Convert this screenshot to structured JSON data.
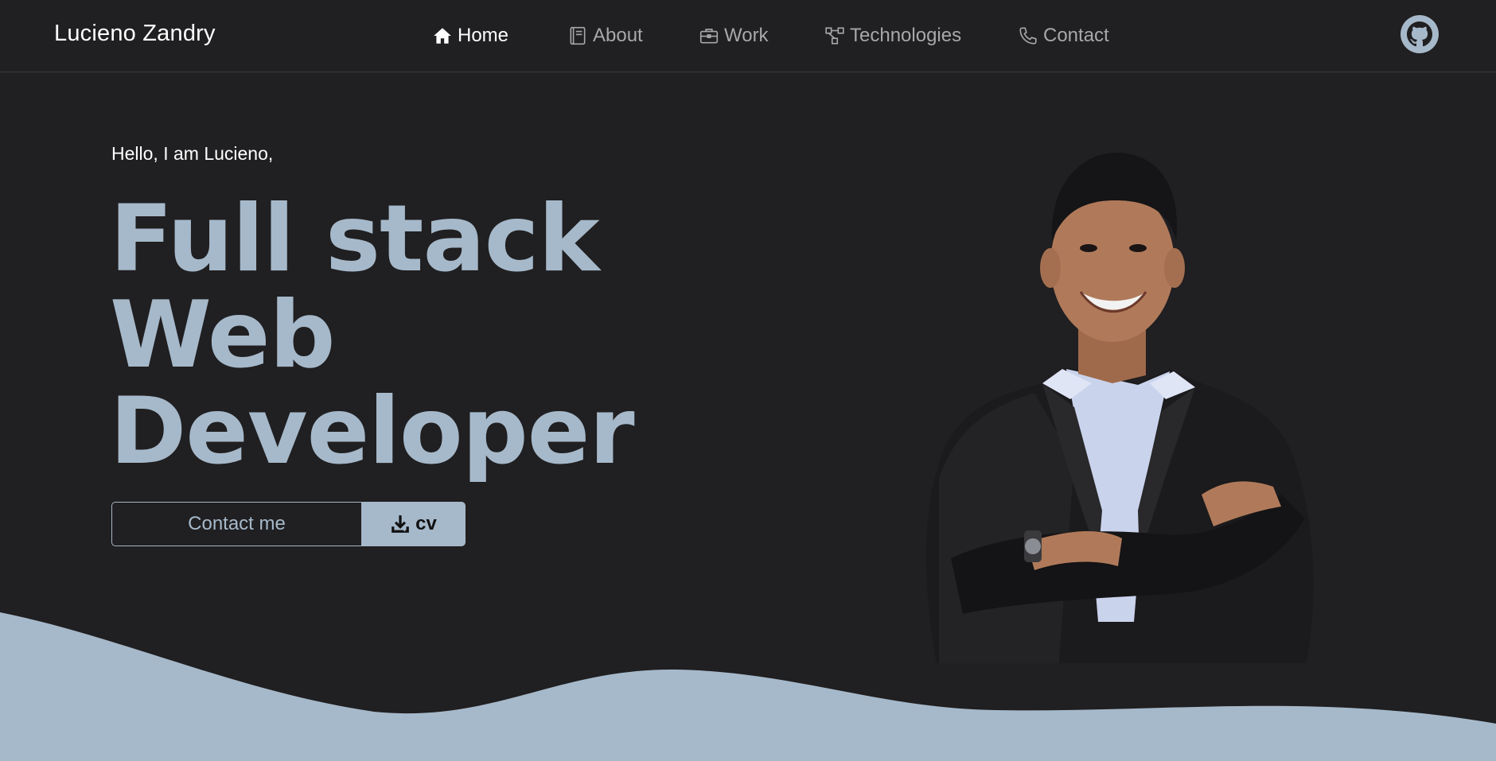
{
  "navbar": {
    "brand": "Lucieno Zandry",
    "items": [
      {
        "label": "Home",
        "icon": "home-icon",
        "active": true
      },
      {
        "label": "About",
        "icon": "book-icon",
        "active": false
      },
      {
        "label": "Work",
        "icon": "briefcase-icon",
        "active": false
      },
      {
        "label": "Technologies",
        "icon": "diagram-icon",
        "active": false
      },
      {
        "label": "Contact",
        "icon": "phone-icon",
        "active": false
      }
    ],
    "github_icon": "github-icon"
  },
  "hero": {
    "greeting": "Hello, I am Lucieno,",
    "title_lines": [
      "Full stack",
      "Web",
      "Developer"
    ],
    "contact_button": "Contact me",
    "cv_button": "cv",
    "cv_icon": "download-icon"
  },
  "colors": {
    "background": "#201f21",
    "accent": "#a6b9ca",
    "nav_inactive": "#a8a7aa",
    "text": "#ffffff"
  }
}
